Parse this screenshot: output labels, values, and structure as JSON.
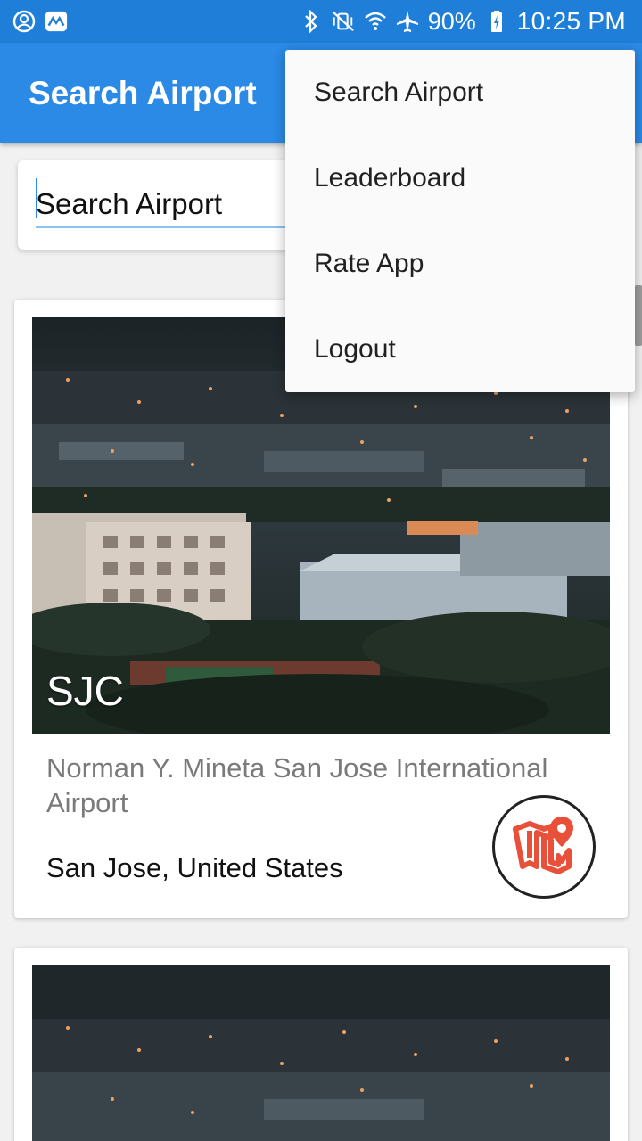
{
  "status_bar": {
    "left_icons": [
      "account-circle-icon",
      "app-notification-icon"
    ],
    "right_icons": [
      "bluetooth-icon",
      "vibrate-mute-icon",
      "wifi-icon",
      "airplane-icon"
    ],
    "battery": "90%",
    "time": "10:25 PM"
  },
  "app_bar": {
    "title": "Search Airport"
  },
  "search": {
    "placeholder": "Search Airport"
  },
  "airports": [
    {
      "code": "SJC",
      "name": "Norman Y. Mineta San Jose International Airport",
      "location": "San Jose, United States",
      "map_icon": "map-pin-icon"
    }
  ],
  "menu": {
    "items": [
      "Search Airport",
      "Leaderboard",
      "Rate App",
      "Logout"
    ]
  },
  "colors": {
    "status_bar": "#1f7fd8",
    "app_bar": "#2a8ae6",
    "map_icon": "#e8503a"
  }
}
